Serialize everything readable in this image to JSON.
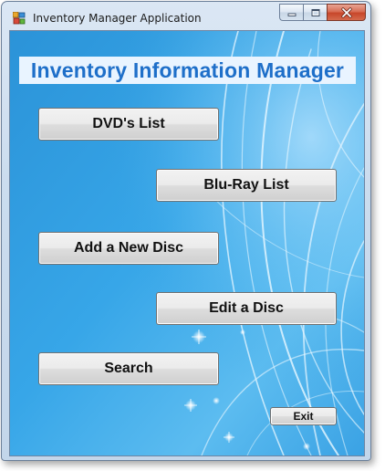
{
  "window": {
    "title": "Inventory Manager Application",
    "icon": "app-window-icon"
  },
  "caption": {
    "minimize_icon": "minimize-icon",
    "maximize_icon": "maximize-icon",
    "close_icon": "close-icon"
  },
  "header": {
    "title": "Inventory Information Manager"
  },
  "buttons": {
    "dvds_list": "DVD's List",
    "bluray_list": "Blu-Ray List",
    "add_disc": "Add a New Disc",
    "edit_disc": "Edit a Disc",
    "search": "Search",
    "exit": "Exit"
  },
  "colors": {
    "background_blue": "#2f9fe0",
    "header_text": "#1e6fc9",
    "header_bg": "#e9f4ff",
    "close_button": "#c7462a"
  }
}
